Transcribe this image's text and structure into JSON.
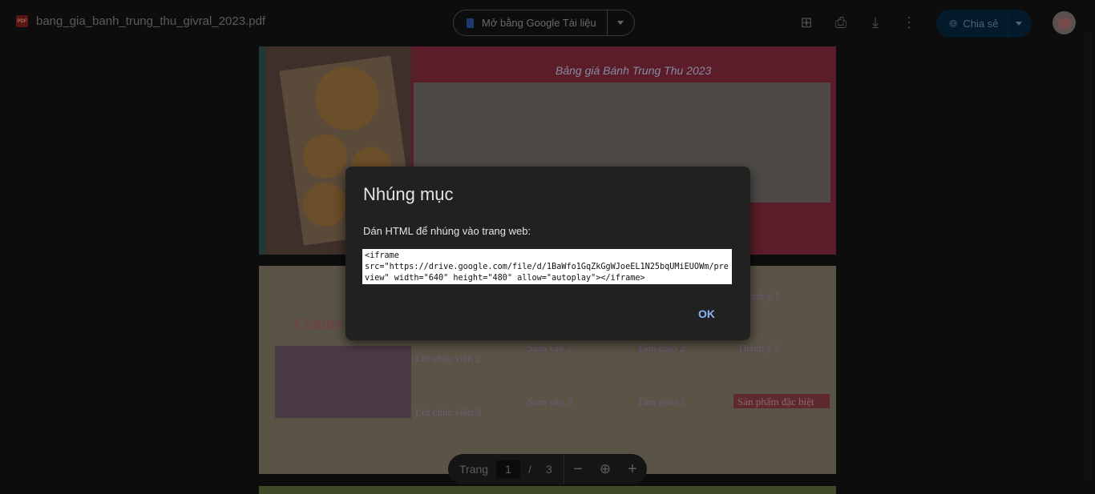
{
  "file": {
    "badge": "PDF",
    "name": "bang_gia_banh_trung_thu_givral_2023.pdf"
  },
  "open_with": {
    "label": "Mở bằng Google Tài liệu"
  },
  "toolbar_icons": [
    "add-comment-icon",
    "print-icon",
    "download-icon",
    "more-vert-icon"
  ],
  "share": {
    "label": "Chia sẻ"
  },
  "pages": {
    "p1_title": "Bảng giá Bánh Trung Thu 2023",
    "p2_combo": "Combo",
    "p2_headings": [
      "Lời chúc viên 2",
      "Lời chúc viên 3",
      "Sum vầy 2",
      "Sum vầy 3",
      "Tâm giao 2",
      "Tâm giao 3",
      "Thành ý 1",
      "Thành ý 2",
      "Sản phẩm đặc biệt"
    ]
  },
  "pager": {
    "label": "Trang",
    "current": "1",
    "separator": "/",
    "total": "3"
  },
  "dialog": {
    "title": "Nhúng mục",
    "label": "Dán HTML để nhúng vào trang web:",
    "code": "<iframe\nsrc=\"https://drive.google.com/file/d/1BaWfo1GqZkGgWJoeEL1N25bqUMiEUOWm/preview\" width=\"640\" height=\"480\" allow=\"autoplay\"></iframe>",
    "ok": "OK"
  },
  "colors": {
    "accent": "#8ab4f8",
    "dialog_bg": "#212121"
  }
}
